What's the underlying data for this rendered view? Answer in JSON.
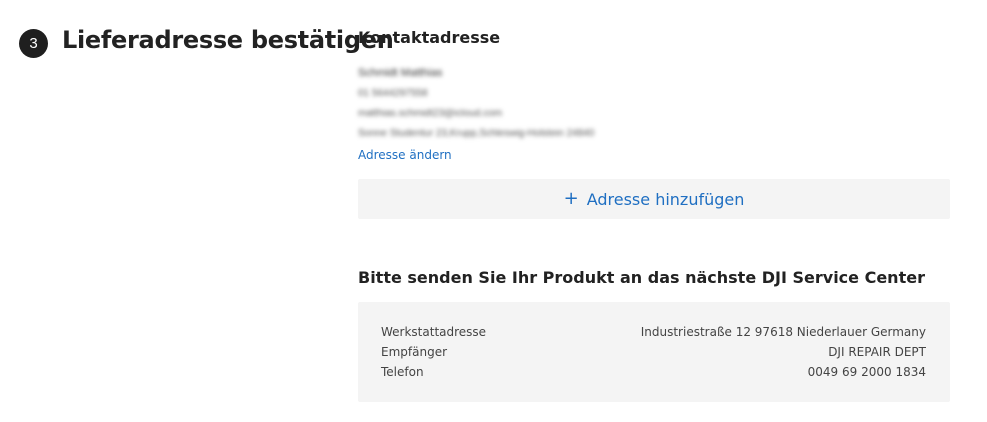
{
  "step": {
    "number": "3",
    "title": "Lieferadresse bestätigen"
  },
  "contact": {
    "title": "Kontaktadresse",
    "blurred_lines": [
      "Schmidt Matthias",
      "01 5644297558",
      "matthias.schmidt23@icloud.com",
      "Sonne Studentur 23,Krupp,Schleswig-Holstein 24840"
    ],
    "change_link": "Adresse ändern"
  },
  "add_address": {
    "icon": "plus-icon",
    "label": "Adresse hinzufügen"
  },
  "service": {
    "title": "Bitte senden Sie Ihr Produkt an das nächste DJI Service Center",
    "rows": [
      {
        "label": "Werkstattadresse",
        "value": "Industriestraße 12 97618 Niederlauer Germany"
      },
      {
        "label": "Empfänger",
        "value": "DJI REPAIR DEPT"
      },
      {
        "label": "Telefon",
        "value": "0049 69 2000 1834"
      }
    ]
  },
  "colors": {
    "link": "#1f6fc2",
    "panel_bg": "#f4f4f4",
    "badge_bg": "#1f1f1f"
  }
}
